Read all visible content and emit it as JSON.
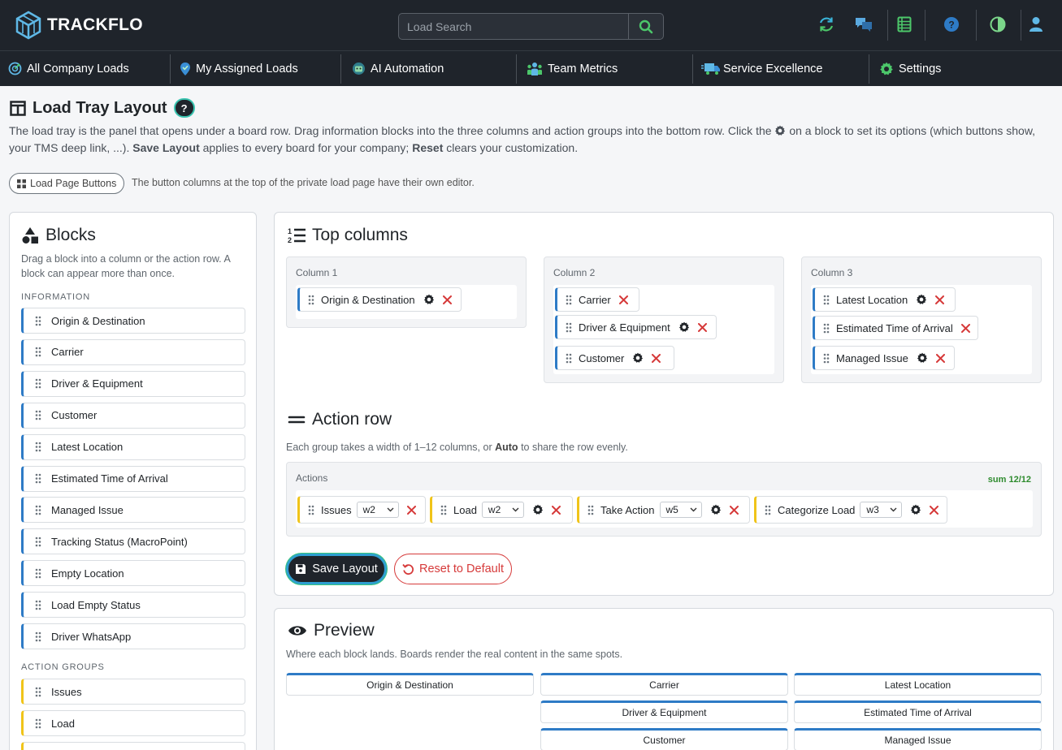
{
  "app": {
    "name": "TRACKFLO"
  },
  "search": {
    "placeholder": "Load Search"
  },
  "nav": [
    {
      "label": "All Company Loads",
      "icon": "radar-icon"
    },
    {
      "label": "My Assigned Loads",
      "icon": "map-pin-icon"
    },
    {
      "label": "AI Automation",
      "icon": "robot-icon"
    },
    {
      "label": "Team Metrics",
      "icon": "team-icon"
    },
    {
      "label": "Service Excellence",
      "icon": "truck-icon"
    },
    {
      "label": "Settings",
      "icon": "gear-icon"
    }
  ],
  "header": {
    "title": "Load Tray Layout",
    "help": "?",
    "intro_p1": "The load tray is the panel that opens under a board row. Drag information blocks into the three columns and action groups into the bottom row. Click the",
    "intro_p2": "on a block to set its options (which buttons show, your TMS deep link, ...).",
    "save_bold": "Save Layout",
    "intro_p3": "applies to every board for your company;",
    "reset_bold": "Reset",
    "intro_p4": "clears your customization.",
    "lpb_label": "Load Page Buttons",
    "lpb_note": "The button columns at the top of the private load page have their own editor."
  },
  "blocks": {
    "title": "Blocks",
    "desc": "Drag a block into a column or the action row. A block can appear more than once.",
    "info_label": "INFORMATION",
    "info_items": [
      "Origin & Destination",
      "Carrier",
      "Driver & Equipment",
      "Customer",
      "Latest Location",
      "Estimated Time of Arrival",
      "Managed Issue",
      "Tracking Status (MacroPoint)",
      "Empty Location",
      "Load Empty Status",
      "Driver WhatsApp"
    ],
    "action_label": "ACTION GROUPS",
    "action_items": [
      "Issues",
      "Load"
    ]
  },
  "top_columns": {
    "title": "Top columns",
    "columns": [
      {
        "label": "Column 1",
        "chips": [
          "Origin & Destination"
        ]
      },
      {
        "label": "Column 2",
        "chips": [
          "Carrier",
          "Driver & Equipment",
          "Customer"
        ]
      },
      {
        "label": "Column 3",
        "chips": [
          "Latest Location",
          "Estimated Time of Arrival",
          "Managed Issue"
        ]
      }
    ]
  },
  "action_row": {
    "title": "Action row",
    "desc_p1": "Each group takes a width of 1–12 columns, or",
    "desc_bold": "Auto",
    "desc_p2": "to share the row evenly.",
    "box_label": "Actions",
    "sum": "sum 12/12",
    "groups": [
      {
        "label": "Issues",
        "width": "w2"
      },
      {
        "label": "Load",
        "width": "w2"
      },
      {
        "label": "Take Action",
        "width": "w5"
      },
      {
        "label": "Categorize Load",
        "width": "w3"
      }
    ]
  },
  "buttons": {
    "save": "Save Layout",
    "reset": "Reset to Default"
  },
  "preview": {
    "title": "Preview",
    "desc": "Where each block lands. Boards render the real content in the same spots.",
    "col1": [
      "Origin & Destination"
    ],
    "col2": [
      "Carrier",
      "Driver & Equipment",
      "Customer"
    ],
    "col3": [
      "Latest Location",
      "Estimated Time of Arrival",
      "Managed Issue"
    ]
  },
  "colors": {
    "accent_blue": "#2e7bc6",
    "action_yellow": "#f0c419",
    "danger": "#d63a3a",
    "topbar": "#1f242b"
  }
}
